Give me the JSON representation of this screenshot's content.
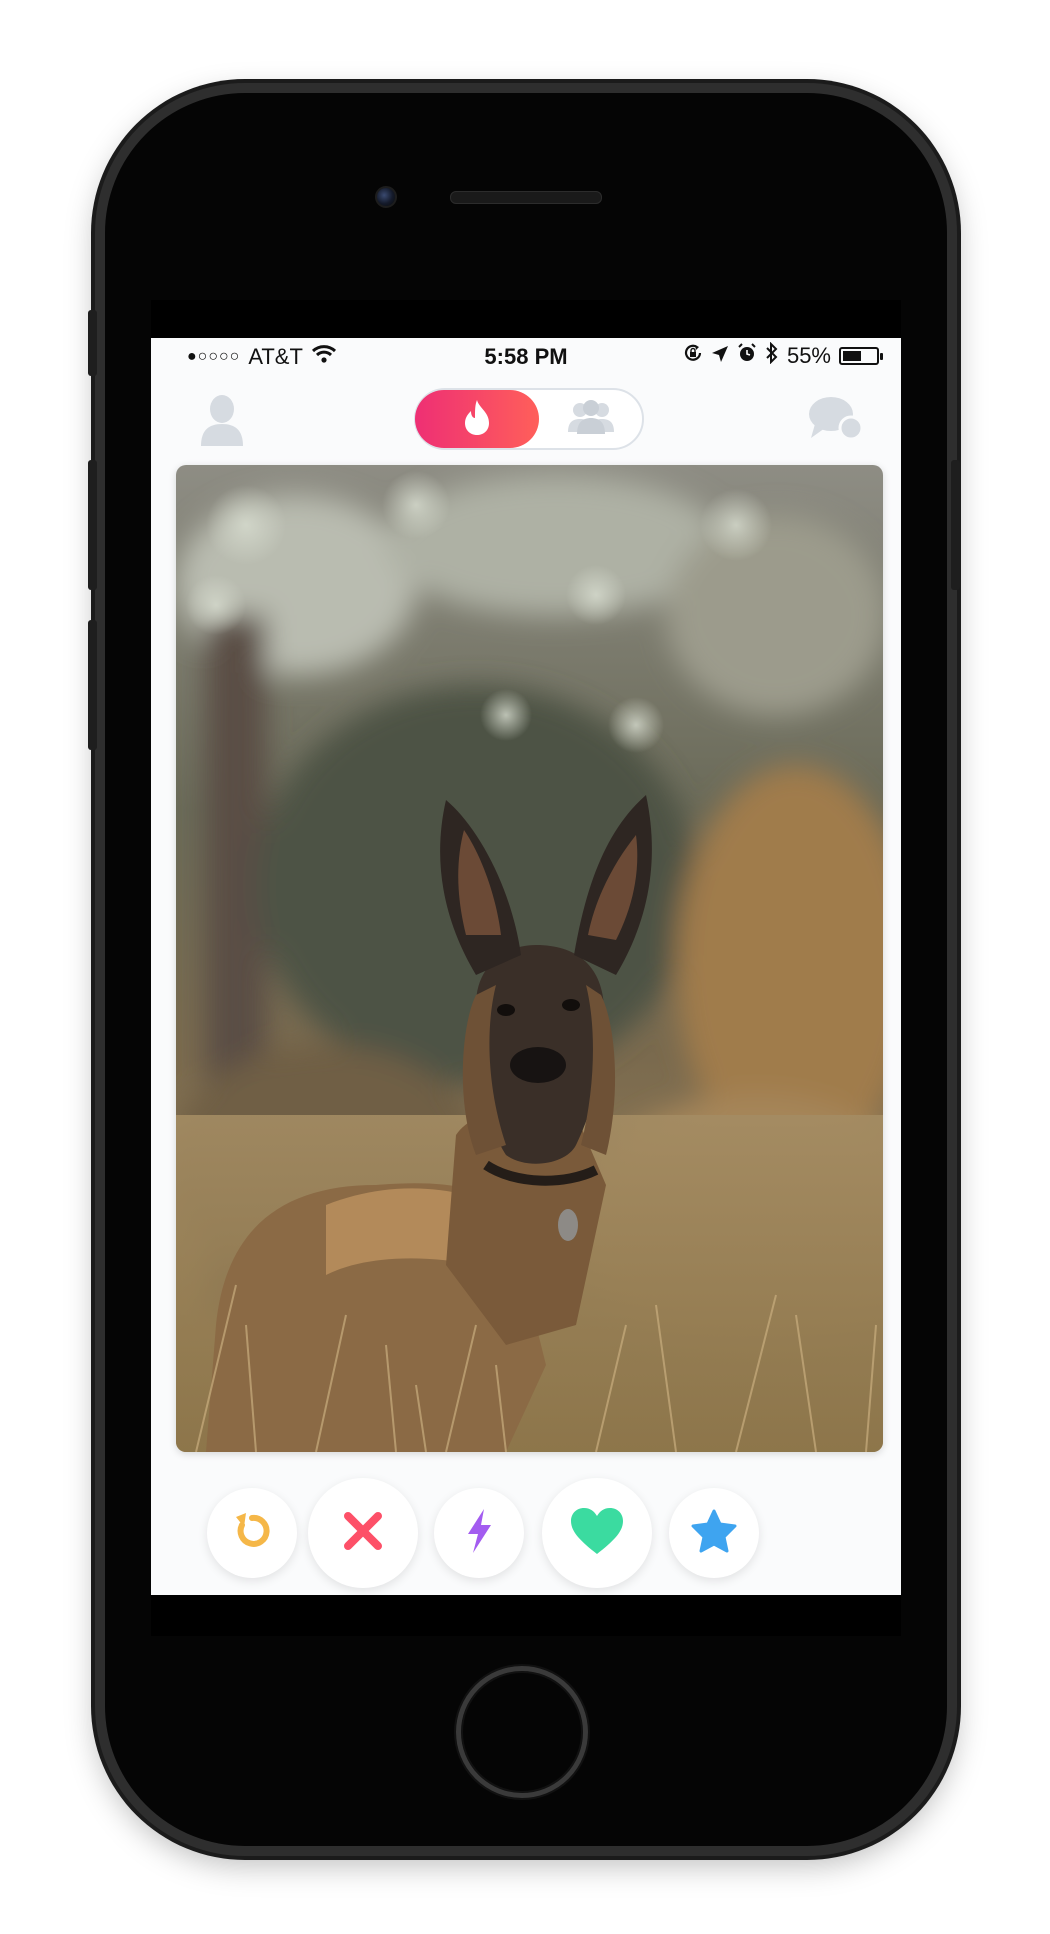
{
  "status_bar": {
    "signal": "●○○○○",
    "carrier": "AT&T",
    "time": "5:58 PM",
    "battery_percent": "55%",
    "battery_level": 0.55,
    "icons": [
      "wifi-icon",
      "lock-rotation-icon",
      "location-icon",
      "alarm-icon",
      "bluetooth-icon",
      "battery-icon"
    ]
  },
  "top_nav": {
    "left_icon": "profile-icon",
    "toggle": {
      "active": "flame-icon",
      "inactive": "group-icon"
    },
    "right_icon": "messages-icon"
  },
  "card": {
    "image": "german-shepherd-dog-in-grass-photo"
  },
  "actions": [
    {
      "name": "rewind",
      "icon": "rewind-icon",
      "color": "#f5b748"
    },
    {
      "name": "nope",
      "icon": "close-icon",
      "color": "#fd5068"
    },
    {
      "name": "boost",
      "icon": "lightning-icon",
      "color": "#a35cf0"
    },
    {
      "name": "like",
      "icon": "heart-icon",
      "color": "#3bdba0"
    },
    {
      "name": "super-like",
      "icon": "star-icon",
      "color": "#3ea4f0"
    }
  ]
}
